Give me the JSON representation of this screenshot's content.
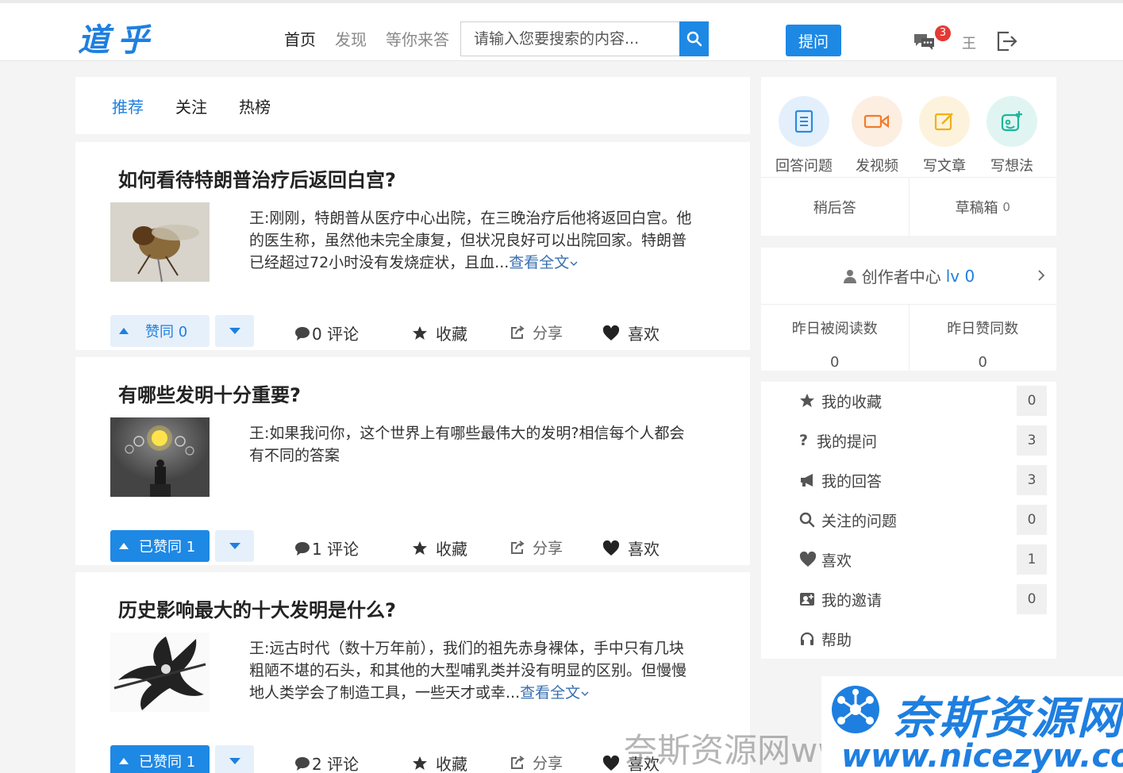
{
  "header": {
    "logo": "道乎",
    "nav": [
      "首页",
      "发现",
      "等你来答"
    ],
    "search_placeholder": "请输入您要搜索的内容...",
    "ask_label": "提问",
    "badge_count": "3",
    "user_name": "王"
  },
  "tabs": [
    "推荐",
    "关注",
    "热榜"
  ],
  "cards": [
    {
      "title": "如何看待特朗普治疗后返回白宫?",
      "excerpt": "王:刚刚，特朗普从医疗中心出院，在三晚治疗后他将返回白宫。他的医生称，虽然他未完全康复，但状况良好可以出院回家。特朗普已经超过72小时没有发烧症状，且血...",
      "more": "查看全文",
      "vote_label": "赞同 0",
      "voted": false,
      "comments": "0 评论"
    },
    {
      "title": "有哪些发明十分重要?",
      "excerpt": "王:如果我问你，这个世界上有哪些最伟大的发明?相信每个人都会有不同的答案",
      "more": "",
      "vote_label": "已赞同 1",
      "voted": true,
      "comments": "1 评论"
    },
    {
      "title": "历史影响最大的十大发明是什么?",
      "excerpt": "王:远古时代（数十万年前），我们的祖先赤身裸体，手中只有几块粗陋不堪的石头，和其他的大型哺乳类并没有明显的区别。但慢慢地人类学会了制造工具，一些天才或幸...",
      "more": "查看全文",
      "vote_label": "已赞同 1",
      "voted": true,
      "comments": "2 评论"
    }
  ],
  "card_actions": {
    "collect": "收藏",
    "share": "分享",
    "like": "喜欢"
  },
  "quick": {
    "items": [
      "回答问题",
      "发视频",
      "写文章",
      "写想法"
    ],
    "later": "稍后答",
    "drafts": "草稿箱",
    "drafts_count": "0"
  },
  "creator": {
    "label": "创作者中心",
    "level": "lv 0",
    "stats": [
      {
        "label": "昨日被阅读数",
        "value": "0"
      },
      {
        "label": "昨日赞同数",
        "value": "0"
      }
    ]
  },
  "menu": [
    {
      "label": "我的收藏",
      "count": "0"
    },
    {
      "label": "我的提问",
      "count": "3"
    },
    {
      "label": "我的回答",
      "count": "3"
    },
    {
      "label": "关注的问题",
      "count": "0"
    },
    {
      "label": "喜欢",
      "count": "1"
    },
    {
      "label": "我的邀请",
      "count": "0"
    },
    {
      "label": "帮助",
      "count": ""
    }
  ],
  "watermark": {
    "brand": "奈斯资源网",
    "url": "www.nicezyw.com",
    "grey": "奈斯资源网www.nicezyw.com"
  }
}
